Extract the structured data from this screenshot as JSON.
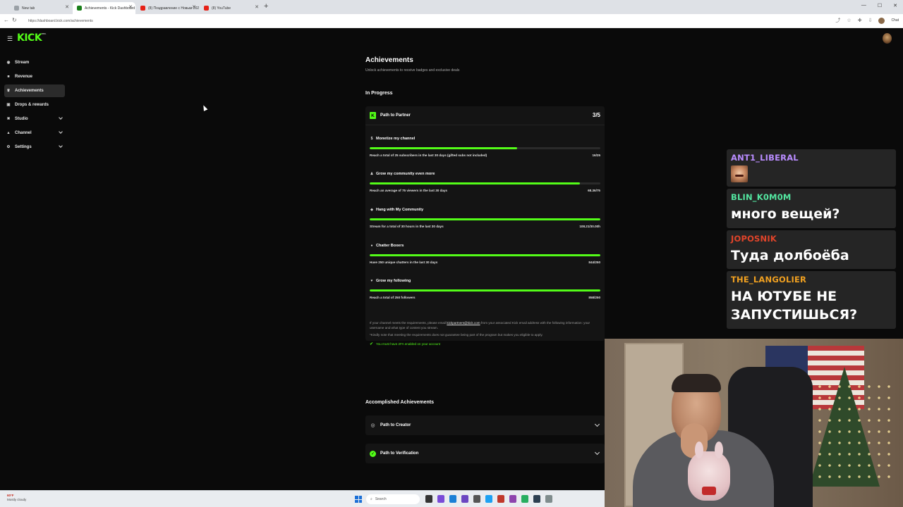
{
  "browser": {
    "tabs": [
      {
        "title": "New tab",
        "color": "#9aa0a6",
        "active": false
      },
      {
        "title": "Achievements - Kick Dashboard",
        "color": "#1a7f1a",
        "active": true
      },
      {
        "title": "(8) Поздравление с Новым 2024",
        "color": "#e62117",
        "active": false
      },
      {
        "title": "(8) YouTube",
        "color": "#e62117",
        "active": false
      }
    ],
    "url": "https://dashboard.kick.com/achievements",
    "chat_label": "Chat"
  },
  "sidebar": {
    "items": [
      {
        "label": "Stream",
        "icon": "stream-icon",
        "glyph": "◉",
        "active": false,
        "expandable": false
      },
      {
        "label": "Revenue",
        "icon": "revenue-icon",
        "glyph": "■",
        "active": false,
        "expandable": false
      },
      {
        "label": "Achievements",
        "icon": "trophy-icon",
        "glyph": "♛",
        "active": true,
        "expandable": false
      },
      {
        "label": "Drops & rewards",
        "icon": "gift-icon",
        "glyph": "▣",
        "active": false,
        "expandable": false
      },
      {
        "label": "Studio",
        "icon": "studio-icon",
        "glyph": "✖",
        "active": false,
        "expandable": true
      },
      {
        "label": "Channel",
        "icon": "channel-icon",
        "glyph": "▲",
        "active": false,
        "expandable": true
      },
      {
        "label": "Settings",
        "icon": "gear-icon",
        "glyph": "⚙",
        "active": false,
        "expandable": true
      }
    ]
  },
  "main": {
    "title": "Achievements",
    "subtitle": "Unlock achievements to receive badges and exclusive deals",
    "in_progress_title": "In Progress",
    "partner": {
      "name": "Path to Partner",
      "count": "3/5",
      "requirements": [
        {
          "title": "Monetize my channel",
          "icon": "dollar-icon",
          "glyph": "$",
          "description": "Reach a total of 25 subscribers in the last 30 days (gifted subs not included)",
          "value": "16/25",
          "progress": 0.64
        },
        {
          "title": "Grow my community even more",
          "icon": "people-icon",
          "glyph": "♟",
          "description": "Reach an average of 75 viewers in the last 30 days",
          "value": "68.36/75",
          "progress": 0.91
        },
        {
          "title": "Hang with My Community",
          "icon": "broadcast-icon",
          "glyph": "◈",
          "description": "Stream for a total of 30 hours in the last 30 days",
          "value": "108.21/30.00h",
          "progress": 1.0
        },
        {
          "title": "Chatter Boxers",
          "icon": "chat-bubble-icon",
          "glyph": "●",
          "description": "Have 250 unique chatters in the last 30 days",
          "value": "844/250",
          "progress": 1.0
        },
        {
          "title": "Grow my following",
          "icon": "heart-icon",
          "glyph": "♥",
          "description": "Reach a total of 250 followers",
          "value": "858/250",
          "progress": 1.0
        }
      ],
      "info_before_email": "If your channel meets the requirements, please email ",
      "info_email": "kickpartners@kick.com",
      "info_after_email": " from your associated Kick email address with the following information: your username and what type of content you stream.",
      "info_note": "*Kindly note that meeting the requirements does not guarantee being part of the program but makes you eligible to apply.",
      "info_2fa": "You must have 2FA enabled on your account"
    },
    "accomplished_title": "Accomplished Achievements",
    "accomplished": [
      {
        "label": "Path to Creator",
        "icon": "broadcast-icon"
      },
      {
        "label": "Path to Verification",
        "icon": "verified-badge-icon"
      }
    ]
  },
  "chat_overlay": {
    "messages": [
      {
        "user": "ANT1_LIBERAL",
        "color": "#b98cff",
        "text": "",
        "emote": true
      },
      {
        "user": "BLIN_K0M0M",
        "color": "#53e6a0",
        "text": "много вещей?",
        "emote": false
      },
      {
        "user": "JOPOSNIK",
        "color": "#e0442a",
        "text": "Туда долбоёба",
        "emote": false
      },
      {
        "user": "THE_LANGOLIER",
        "color": "#f0a020",
        "text": "НА ЮТУБЕ НЕ ЗАПУСТИШЬСЯ?",
        "emote": false
      }
    ]
  },
  "taskbar": {
    "weather_temp": "60°F",
    "weather_desc": "Mostly cloudy",
    "search_placeholder": "Search"
  },
  "colors": {
    "accent": "#53fc18",
    "background": "#0a0a0a",
    "card": "#141414"
  }
}
